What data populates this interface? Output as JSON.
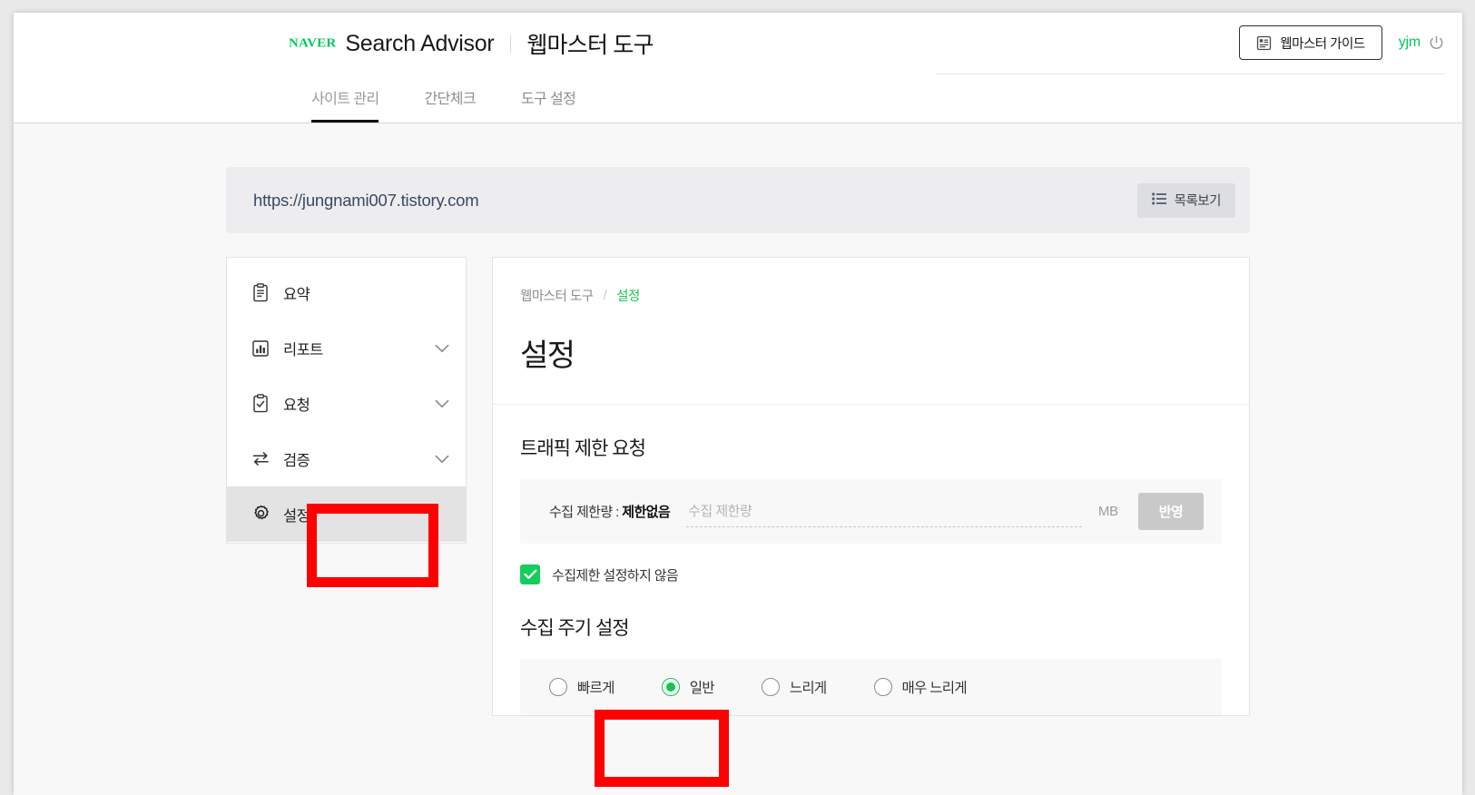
{
  "header": {
    "logo_text": "NAVER",
    "product_name": "Search Advisor",
    "sub_title": "웹마스터 도구",
    "guide_button": "웹마스터 가이드",
    "guide_icon": "guide-book-icon",
    "user_id": "yjm",
    "logout_icon": "power-icon"
  },
  "tabs": [
    {
      "label": "사이트 관리",
      "active": true
    },
    {
      "label": "간단체크",
      "active": false
    },
    {
      "label": "도구 설정",
      "active": false
    }
  ],
  "site_bar": {
    "url": "https://jungnami007.tistory.com",
    "list_button": "목록보기",
    "list_icon": "list-icon"
  },
  "sidebar": {
    "items": [
      {
        "label": "요약",
        "icon": "clipboard-icon",
        "expandable": false,
        "selected": false
      },
      {
        "label": "리포트",
        "icon": "bar-chart-icon",
        "expandable": true,
        "selected": false
      },
      {
        "label": "요청",
        "icon": "clipboard-check-icon",
        "expandable": true,
        "selected": false
      },
      {
        "label": "검증",
        "icon": "exchange-arrows-icon",
        "expandable": true,
        "selected": false
      },
      {
        "label": "설정",
        "icon": "gear-icon",
        "expandable": false,
        "selected": true
      }
    ]
  },
  "panel": {
    "breadcrumb": {
      "root": "웹마스터 도구",
      "separator": "/",
      "current": "설정"
    },
    "title": "설정",
    "traffic": {
      "section_title": "트래픽 제한 요청",
      "field_label_prefix": "수집 제한량 : ",
      "field_label_value": "제한없음",
      "input_value": "",
      "input_placeholder": "수집 제한량",
      "unit": "MB",
      "apply_button": "반영",
      "checkbox_label": "수집제한 설정하지 않음",
      "checkbox_checked": true
    },
    "cycle": {
      "section_title": "수집 주기 설정",
      "options": [
        {
          "label": "빠르게",
          "selected": false
        },
        {
          "label": "일반",
          "selected": true
        },
        {
          "label": "느리게",
          "selected": false
        },
        {
          "label": "매우 느리게",
          "selected": false
        }
      ]
    }
  },
  "annotations": {
    "highlight_color": "#fe0000",
    "boxes": [
      "sidebar-settings-item",
      "cycle-option-fast"
    ]
  }
}
